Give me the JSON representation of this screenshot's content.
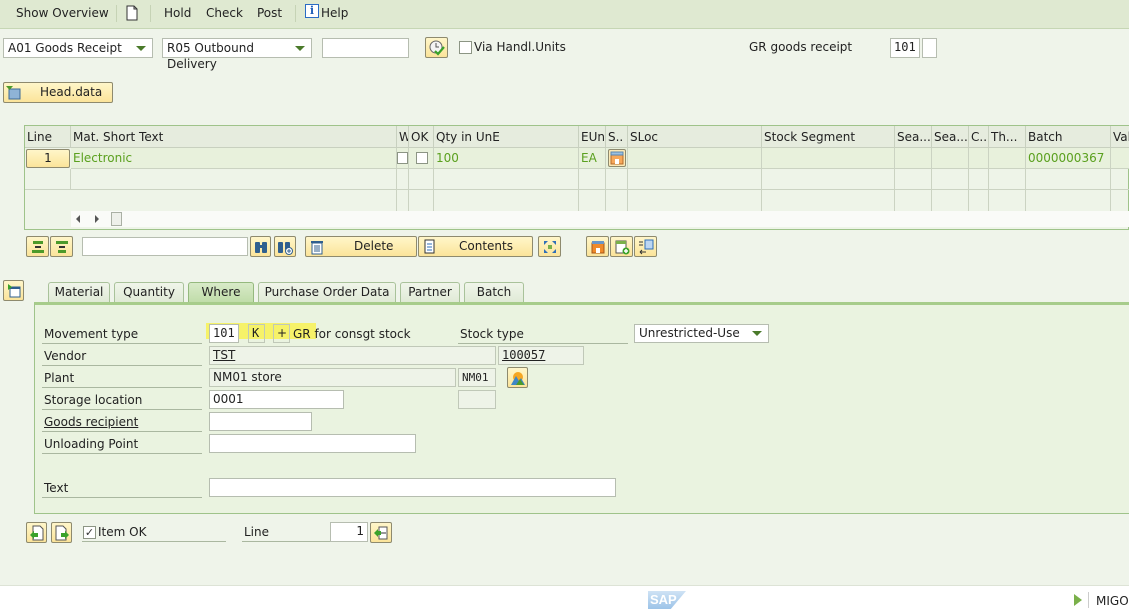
{
  "menu": {
    "show_overview": "Show Overview",
    "new_doc_icon": "document-icon",
    "hold": "Hold",
    "check": "Check",
    "post": "Post",
    "help": "Help"
  },
  "header": {
    "action_select": "A01 Goods Receipt",
    "ref_doc_select": "R05 Outbound Delivery",
    "ref_doc_number": "",
    "via_handling_units_label": "Via Handl.Units",
    "via_handling_units_checked": false,
    "gr_label": "GR goods receipt",
    "movement_type": "101",
    "movement_type_ext": ""
  },
  "head_data_button": "Head.data",
  "table": {
    "columns": [
      "Line",
      "Mat. Short Text",
      "W",
      "OK",
      "Qty in UnE",
      "EUn",
      "S..",
      "SLoc",
      "Stock Segment",
      "Sea...",
      "Sea...",
      "C..",
      "Th...",
      "Batch",
      "Val"
    ],
    "rows": [
      {
        "line": "1",
        "mat_short_text": "Electronic",
        "w_checked": false,
        "ok_checked": false,
        "qty": "100",
        "eun": "EA",
        "sloc": "",
        "stock_segment": "",
        "batch": "0000000367"
      }
    ]
  },
  "table_toolbar": {
    "search_value": "",
    "delete_label": "Delete",
    "contents_label": "Contents"
  },
  "tabs": [
    {
      "label": "Material",
      "active": false
    },
    {
      "label": "Quantity",
      "active": false
    },
    {
      "label": "Where",
      "active": true
    },
    {
      "label": "Purchase Order Data",
      "active": false
    },
    {
      "label": "Partner",
      "active": false
    },
    {
      "label": "Batch",
      "active": false
    }
  ],
  "where": {
    "movement_type_label": "Movement type",
    "movement_type": "101",
    "special_stock": "K",
    "debit_credit": "+",
    "movement_type_text": "GR for consgt stock",
    "stock_type_label": "Stock type",
    "stock_type": "Unrestricted-Use",
    "vendor_label": "Vendor",
    "vendor_name": "TST",
    "vendor_number": "100057",
    "plant_label": "Plant",
    "plant_name": "NM01 store",
    "plant_code": "NM01",
    "storage_location_label": "Storage location",
    "storage_location": "0001",
    "storage_location_desc": "",
    "goods_recipient_label": "Goods recipient",
    "goods_recipient": "",
    "unloading_point_label": "Unloading Point",
    "unloading_point": "",
    "text_label": "Text",
    "text": ""
  },
  "bottom": {
    "item_ok_label": "Item OK",
    "item_ok_checked": true,
    "line_label": "Line",
    "line_value": "1"
  },
  "status": {
    "logo": "SAP",
    "transaction": "MIGO"
  }
}
